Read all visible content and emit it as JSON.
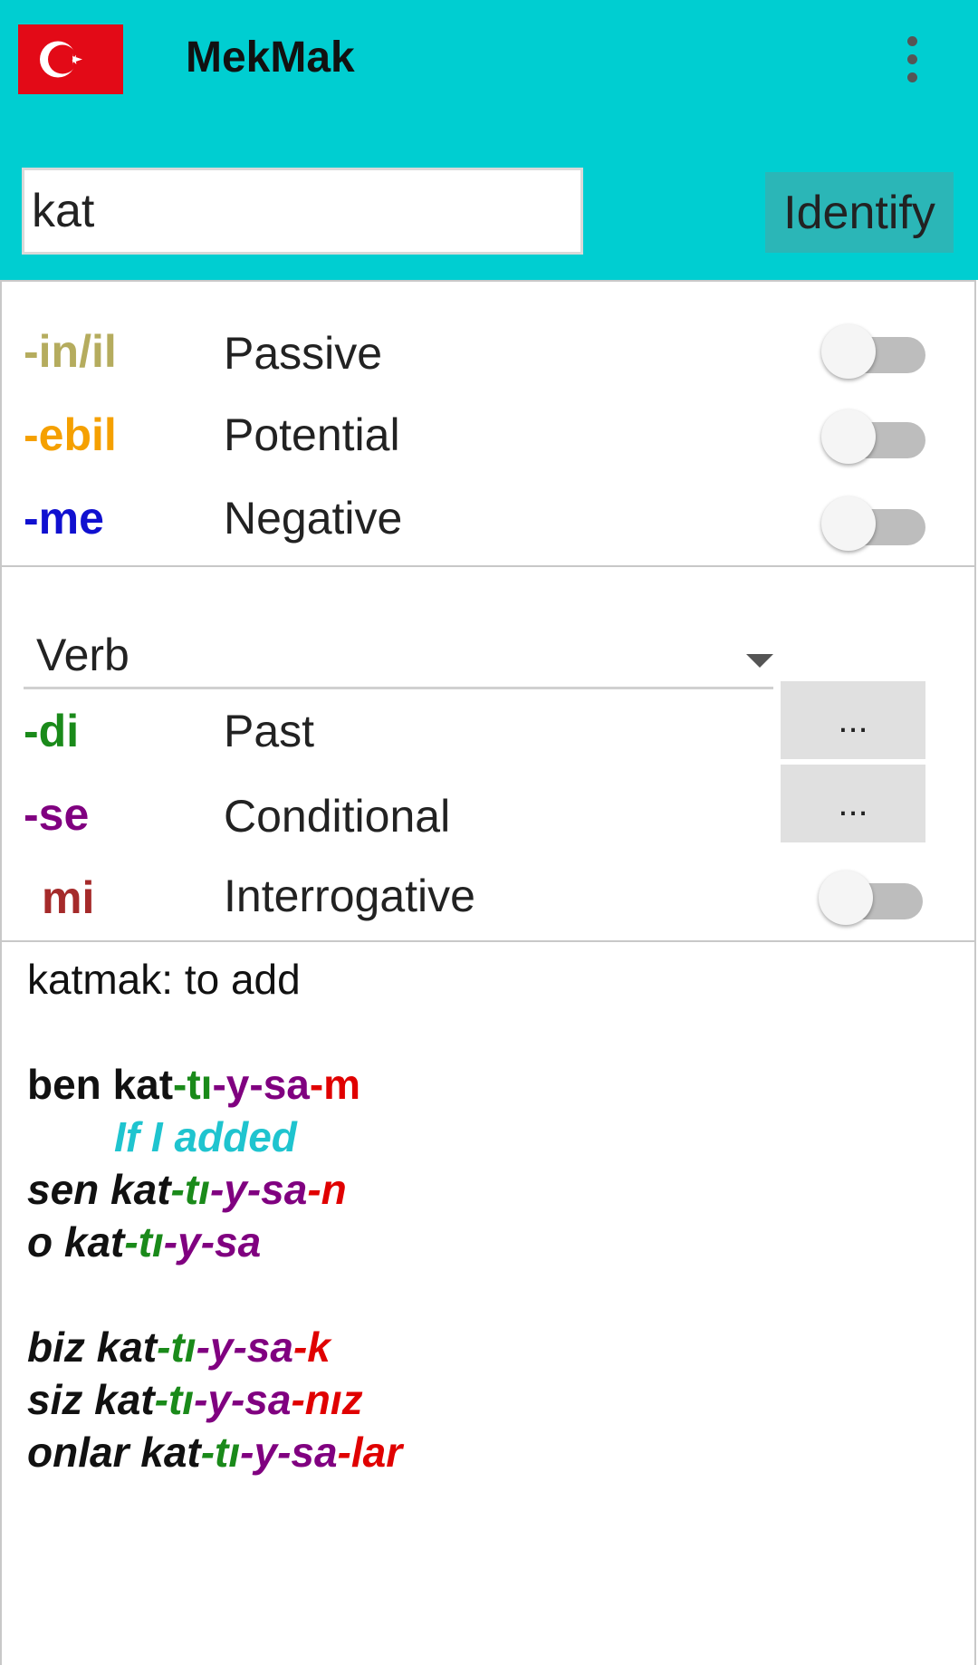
{
  "header": {
    "title": "MekMak",
    "flag_icon": "turkish-flag-icon",
    "menu_icon": "more-vertical-icon",
    "background_color": "#00ced1"
  },
  "search": {
    "value": "kat",
    "identify_label": "Identify"
  },
  "modifiers": [
    {
      "suffix": "-in/il",
      "label": "Passive",
      "color": "#b5ac5e",
      "on": false
    },
    {
      "suffix": "-ebil",
      "label": "Potential",
      "color": "#f5a000",
      "on": false
    },
    {
      "suffix": "-me",
      "label": "Negative",
      "color": "#1010d0",
      "on": false
    }
  ],
  "mood": {
    "selected": "Verb",
    "rows": [
      {
        "suffix": "-di",
        "label": "Past",
        "color": "#1a8a1a",
        "control": "more",
        "button_label": "..."
      },
      {
        "suffix": "-se",
        "label": "Conditional",
        "color": "#800080",
        "control": "more",
        "button_label": "..."
      },
      {
        "suffix": "mi",
        "label": "Interrogative",
        "color": "#a52a2a",
        "control": "switch",
        "on": false
      }
    ]
  },
  "result": {
    "definition": "katmak: to add",
    "conjugations": [
      {
        "pronoun": "ben",
        "stem": "kat",
        "tense": "-tı",
        "buffer": "-y",
        "mood": "-sa",
        "person": "-m",
        "meaning": "If I added"
      },
      {
        "pronoun": "sen",
        "stem": "kat",
        "tense": "-tı",
        "buffer": "-y",
        "mood": "-sa",
        "person": "-n"
      },
      {
        "pronoun": "o",
        "stem": "kat",
        "tense": "-tı",
        "buffer": "-y",
        "mood": "-sa",
        "person": ""
      },
      {
        "pronoun": "biz",
        "stem": "kat",
        "tense": "-tı",
        "buffer": "-y",
        "mood": "-sa",
        "person": "-k"
      },
      {
        "pronoun": "siz",
        "stem": "kat",
        "tense": "-tı",
        "buffer": "-y",
        "mood": "-sa",
        "person": "-nız"
      },
      {
        "pronoun": "onlar",
        "stem": "kat",
        "tense": "-tı",
        "buffer": "-y",
        "mood": "-sa",
        "person": "-lar"
      }
    ]
  }
}
